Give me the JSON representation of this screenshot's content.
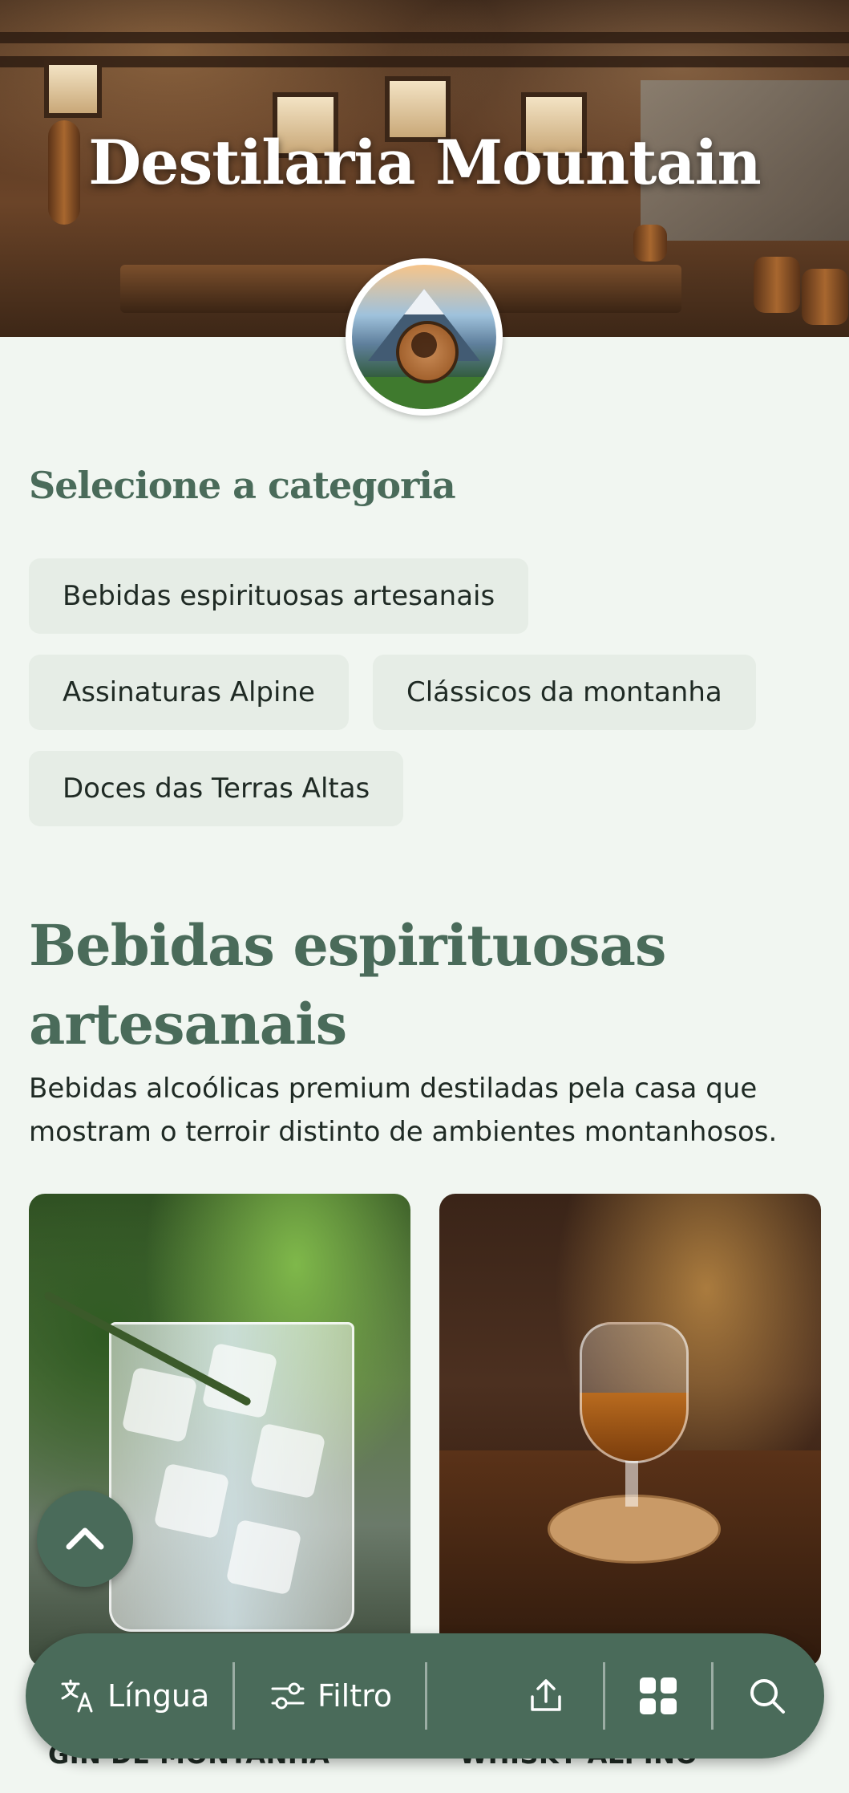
{
  "header": {
    "title": "Destilaria Mountain"
  },
  "category_selector": {
    "label": "Selecione a categoria",
    "chips": [
      "Bebidas espirituosas artesanais",
      "Assinaturas Alpine",
      "Clássicos da montanha",
      "Doces das Terras Altas"
    ]
  },
  "category": {
    "title": "Bebidas espirituosas artesanais",
    "description": "Bebidas alcoólicas premium destiladas pela casa que mostram o terroir distinto de ambientes montanhosos."
  },
  "products": [
    {
      "name": "GIN DE MONTANHA"
    },
    {
      "name": "WHISKY ALPINO"
    }
  ],
  "bottom_bar": {
    "language_label": "Língua",
    "filter_label": "Filtro"
  },
  "colors": {
    "accent": "#4a6b5a",
    "background": "#f1f6f1",
    "chip": "#e6ede6"
  }
}
